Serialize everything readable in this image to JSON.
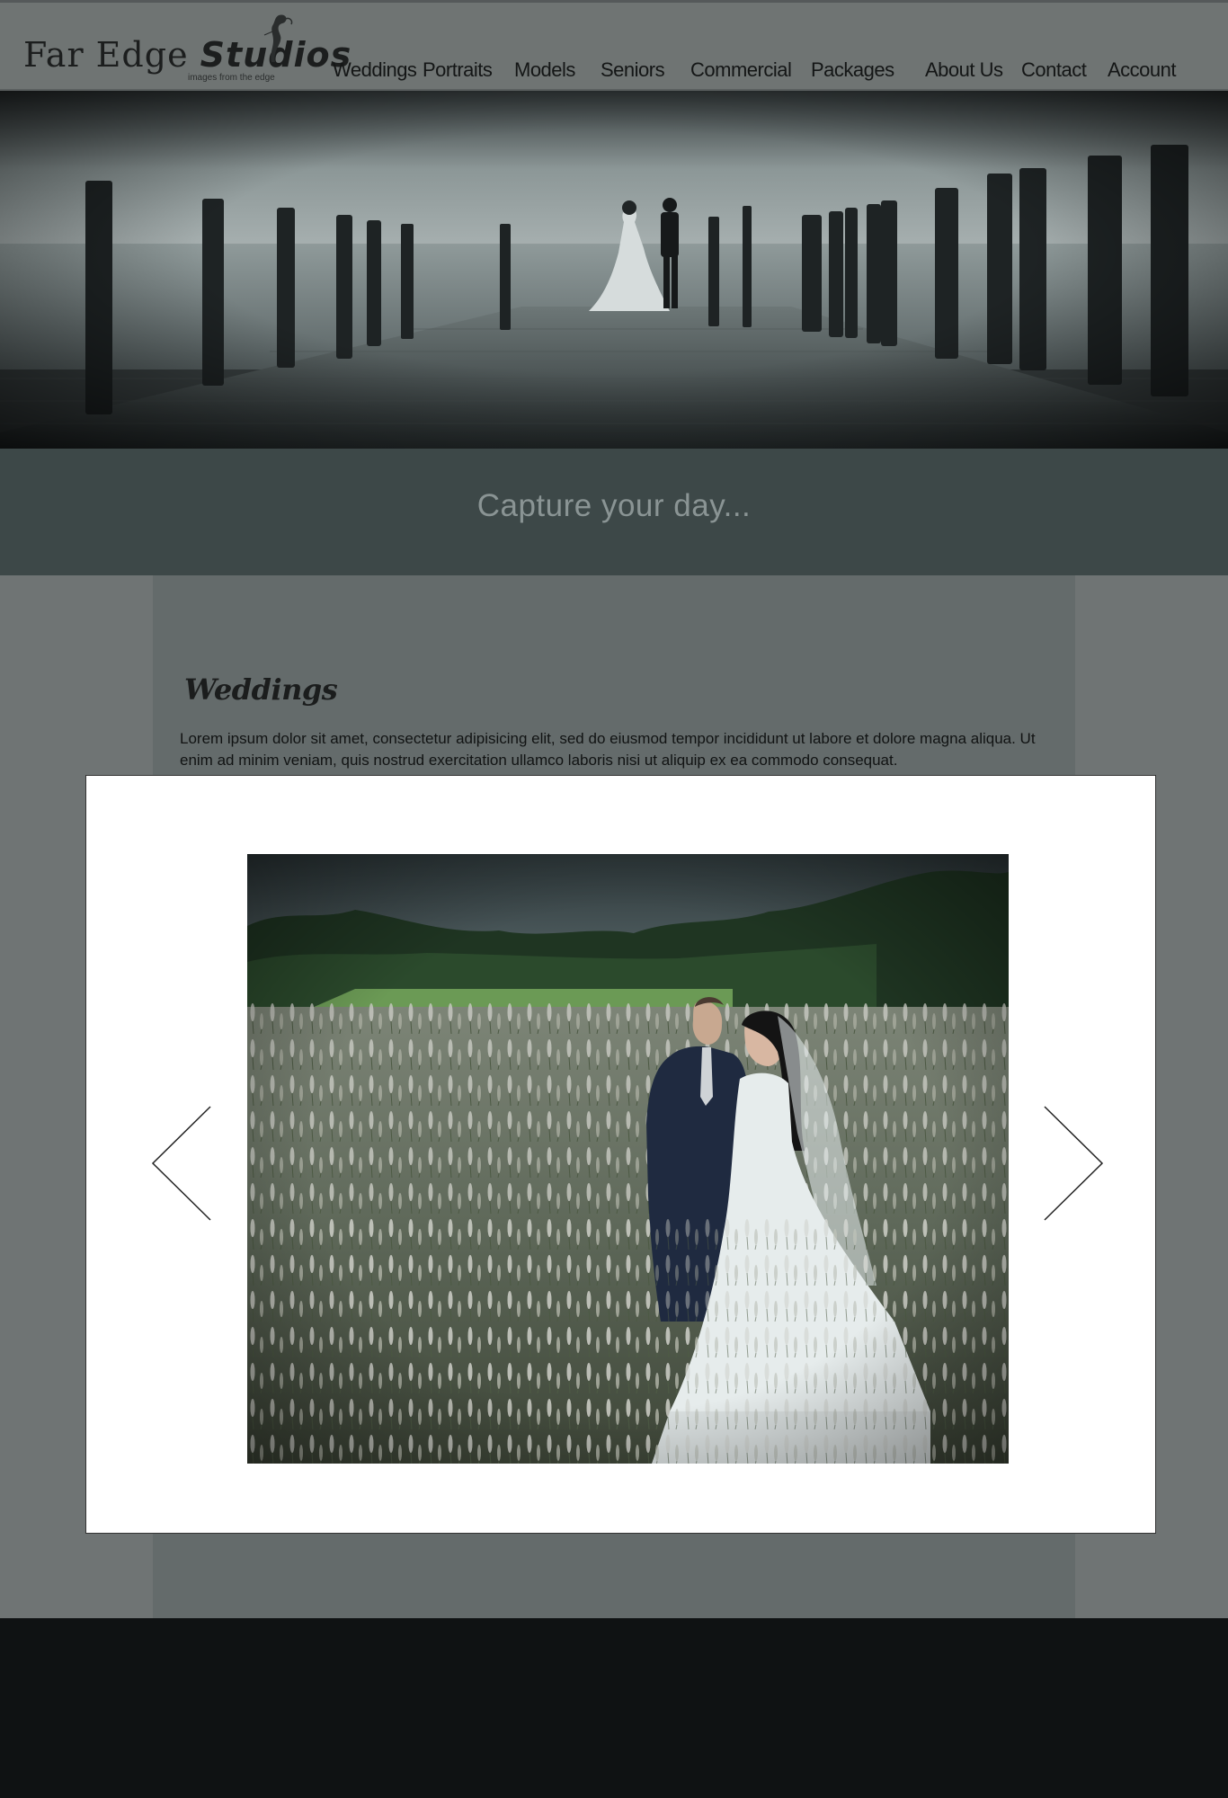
{
  "brand": {
    "name_part1": "Far Edge",
    "name_part2": "Studios",
    "tagline": "images from the edge"
  },
  "nav": {
    "items": [
      {
        "id": "weddings",
        "label": "Weddings"
      },
      {
        "id": "portraits",
        "label": "Portraits"
      },
      {
        "id": "models",
        "label": "Models"
      },
      {
        "id": "seniors",
        "label": "Seniors"
      },
      {
        "id": "commercial",
        "label": "Commercial"
      },
      {
        "id": "packages",
        "label": "Packages"
      },
      {
        "id": "about",
        "label": "About Us"
      },
      {
        "id": "contact",
        "label": "Contact"
      },
      {
        "id": "account",
        "label": "Account"
      }
    ]
  },
  "hero": {
    "tagline": "Capture your day..."
  },
  "section": {
    "title": "Weddings",
    "body": "Lorem ipsum dolor sit amet, consectetur adipisicing elit, sed do eiusmod tempor incididunt ut labore et dolore magna aliqua. Ut enim ad minim veniam, quis nostrud exercitation ullamco laboris nisi ut aliquip ex ea commodo consequat."
  },
  "colors": {
    "header_bg": "#6f7473",
    "tagline_band": "#3d4848",
    "content_bg": "#646b6b",
    "footer_bg": "#0f1213"
  }
}
